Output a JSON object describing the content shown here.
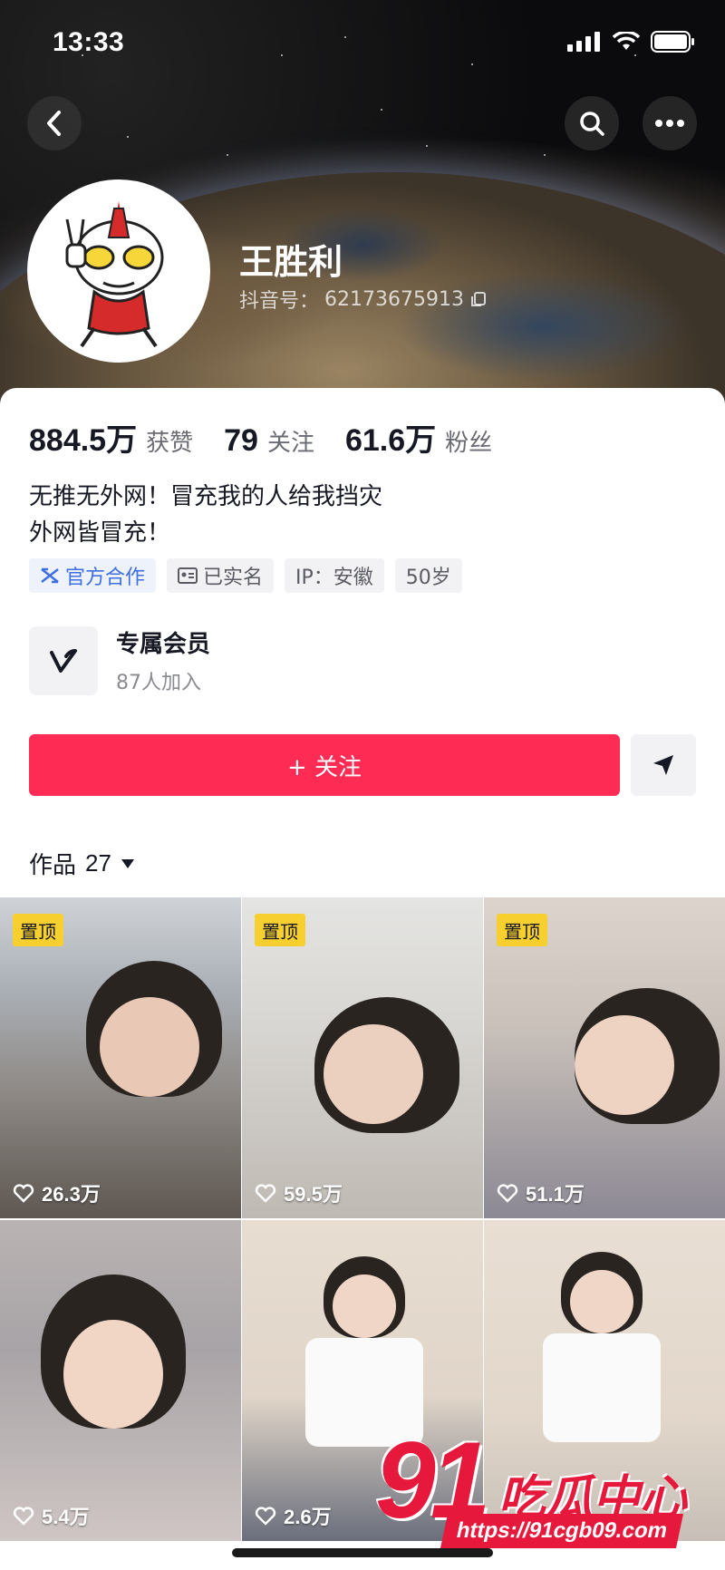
{
  "status_bar": {
    "time": "13:33"
  },
  "profile": {
    "name": "王胜利",
    "uid_label": "抖音号：",
    "uid": "62173675913"
  },
  "stats": [
    {
      "num": "884.5万",
      "label": "获赞"
    },
    {
      "num": "79",
      "label": "关注"
    },
    {
      "num": "61.6万",
      "label": "粉丝"
    }
  ],
  "bio": {
    "line1": "无推无外网！冒充我的人给我挡灾",
    "line2": "外网皆冒充！"
  },
  "tags": {
    "official": "官方合作",
    "verified": "已实名",
    "ip": "IP：安徽",
    "age": "50岁"
  },
  "vip": {
    "title": "专属会员",
    "subtitle": "87人加入"
  },
  "follow_button": "+ 关注",
  "works": {
    "label": "作品",
    "count": "27"
  },
  "grid": [
    {
      "pinned": "置顶",
      "likes": "26.3万"
    },
    {
      "pinned": "置顶",
      "likes": "59.5万"
    },
    {
      "pinned": "置顶",
      "likes": "51.1万"
    },
    {
      "pinned": "",
      "likes": "5.4万"
    },
    {
      "pinned": "",
      "likes": "2.6万"
    },
    {
      "pinned": "",
      "likes": ""
    }
  ],
  "watermark": {
    "big": "91",
    "cn": "吃瓜中心",
    "url": "https://91cgb09.com"
  },
  "icons": {
    "back": "chevron-left-icon",
    "search": "search-icon",
    "more": "more-dots-icon",
    "share": "send-icon",
    "heart": "heart-icon",
    "dropdown": "caret-down-icon"
  },
  "colors": {
    "accent": "#fe2c55",
    "pin": "#f7cf2e",
    "official": "#3f6fe0"
  }
}
